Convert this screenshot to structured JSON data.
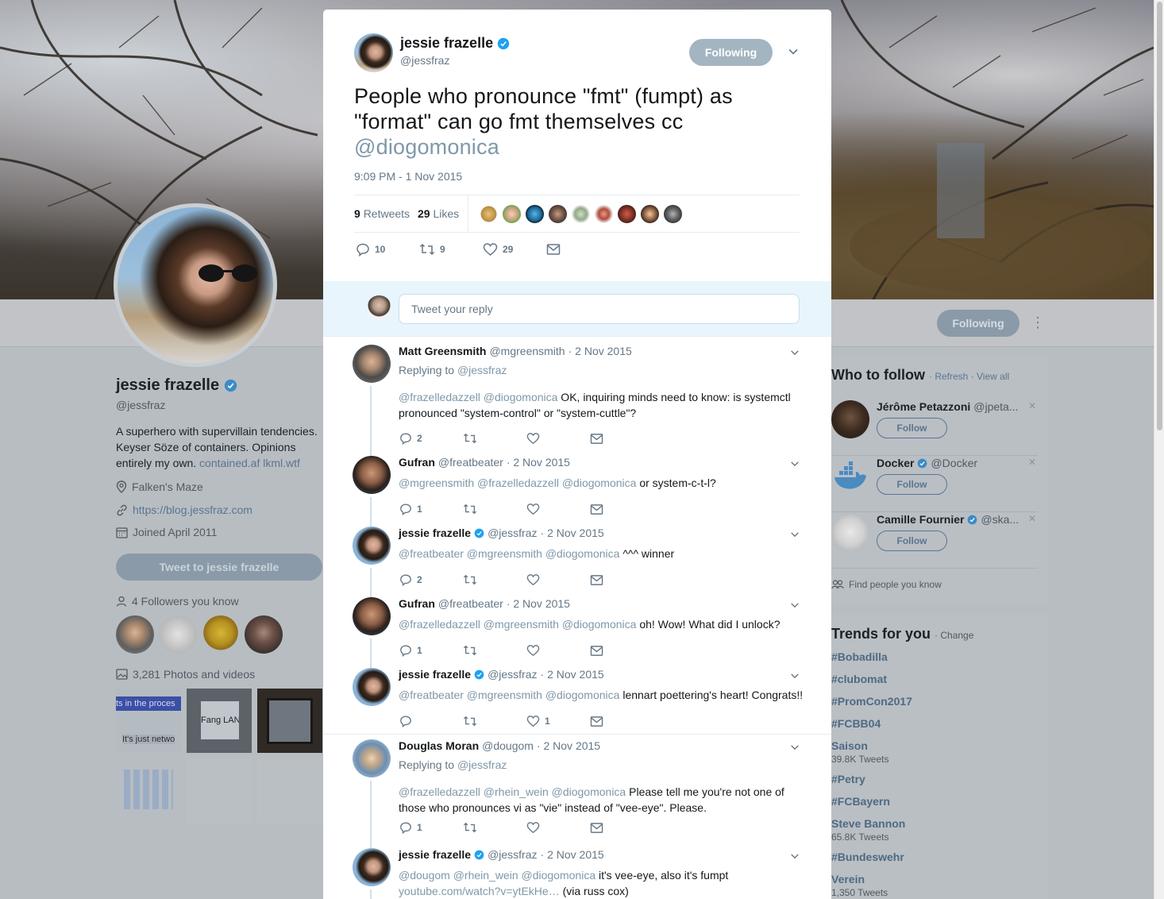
{
  "colors": {
    "accent": "#1da1f2",
    "mention": "#7f98a9",
    "following_button": "#a3b5c1",
    "reply_bar_bg": "#e8f5fd"
  },
  "profile": {
    "name": "jessie frazelle",
    "handle": "@jessfraz",
    "bio_text": "A superhero with supervillain tendencies. Keyser Söze of containers. Opinions entirely my own.",
    "bio_links": [
      "contained.af",
      "lkml.wtf"
    ],
    "location": "Falken's Maze",
    "website": "https://blog.jessfraz.com",
    "joined": "Joined April 2011",
    "tweet_to_button": "Tweet to jessie frazelle",
    "followers_you_know": "4 Followers you know",
    "photos_videos": "3,281 Photos and videos",
    "following_button": "Following",
    "photo_tile_texts": [
      "ts in the proces",
      "It's just netwo",
      "Fang LAN"
    ]
  },
  "who_to_follow": {
    "title": "Who to follow",
    "refresh": "Refresh",
    "view_all": "View all",
    "users": [
      {
        "name": "Jérôme Petazzoni",
        "handle": "@jpeta...",
        "button": "Follow",
        "verified": false
      },
      {
        "name": "Docker",
        "handle": "@Docker",
        "button": "Follow",
        "verified": true
      },
      {
        "name": "Camille Fournier",
        "handle": "@ska...",
        "button": "Follow",
        "verified": true
      }
    ],
    "find_people": "Find people you know"
  },
  "trends": {
    "title": "Trends for you",
    "change": "Change",
    "items": [
      {
        "tag": "#Bobadilla",
        "count": ""
      },
      {
        "tag": "#clubomat",
        "count": ""
      },
      {
        "tag": "#PromCon2017",
        "count": ""
      },
      {
        "tag": "#FCBB04",
        "count": ""
      },
      {
        "tag": "Saison",
        "count": "39.8K Tweets"
      },
      {
        "tag": "#Petry",
        "count": ""
      },
      {
        "tag": "#FCBayern",
        "count": ""
      },
      {
        "tag": "Steve Bannon",
        "count": "65.8K Tweets"
      },
      {
        "tag": "#Bundeswehr",
        "count": ""
      },
      {
        "tag": "Verein",
        "count": "1,350 Tweets"
      }
    ]
  },
  "modal": {
    "author_name": "jessie frazelle",
    "author_handle": "@jessfraz",
    "following_button": "Following",
    "tweet_text_before": "People who pronounce \"fmt\" (fumpt) as \"format\" can go fmt themselves cc ",
    "tweet_mention": "@diogomonica",
    "timestamp": "9:09 PM - 1 Nov 2015",
    "retweets_count": "9",
    "retweets_label": "Retweets",
    "likes_count": "29",
    "likes_label": "Likes",
    "actions": {
      "replies": "10",
      "retweets": "9",
      "likes": "29"
    },
    "reply_placeholder": "Tweet your reply"
  },
  "replies": [
    {
      "name": "Matt Greensmith",
      "handle": "@mgreensmith",
      "date": "· 2 Nov 2015",
      "verified": false,
      "replying_to_label": "Replying to",
      "replying_to": "@jessfraz",
      "mentions": "@frazelledazzell @diogomonica",
      "text": " OK,  inquiring minds need to know: is systemctl pronounced \"system-control\" or \"system-cuttle\"?",
      "reply_count": "2",
      "retweet_count": "",
      "like_count": ""
    },
    {
      "name": "Gufran",
      "handle": "@freatbeater",
      "date": "· 2 Nov 2015",
      "verified": false,
      "mentions": "@mgreensmith @frazelledazzell @diogomonica",
      "text": " or system-c-t-l?",
      "reply_count": "1",
      "retweet_count": "",
      "like_count": ""
    },
    {
      "name": "jessie frazelle",
      "handle": "@jessfraz",
      "date": "· 2 Nov 2015",
      "verified": true,
      "mentions": "@freatbeater @mgreensmith @diogomonica",
      "text": " ^^^ winner",
      "reply_count": "2",
      "retweet_count": "",
      "like_count": ""
    },
    {
      "name": "Gufran",
      "handle": "@freatbeater",
      "date": "· 2 Nov 2015",
      "verified": false,
      "mentions": "@frazelledazzell @mgreensmith @diogomonica",
      "text": " oh! Wow! What did I unlock?",
      "reply_count": "1",
      "retweet_count": "",
      "like_count": ""
    },
    {
      "name": "jessie frazelle",
      "handle": "@jessfraz",
      "date": "· 2 Nov 2015",
      "verified": true,
      "mentions": "@freatbeater @mgreensmith @diogomonica",
      "text": " lennart poettering's heart! Congrats!!",
      "reply_count": "",
      "retweet_count": "",
      "like_count": "1"
    },
    {
      "name": "Douglas Moran",
      "handle": "@dougom",
      "date": "· 2 Nov 2015",
      "verified": false,
      "replying_to_label": "Replying to",
      "replying_to": "@jessfraz",
      "mentions": "@frazelledazzell @rhein_wein @diogomonica",
      "text": " Please tell me you're not one of those who pronounces vi as \"vie\" instead of \"vee-eye\". Please.",
      "reply_count": "1",
      "retweet_count": "",
      "like_count": ""
    },
    {
      "name": "jessie frazelle",
      "handle": "@jessfraz",
      "date": "· 2 Nov 2015",
      "verified": true,
      "mentions": "@dougom @rhein_wein @diogomonica",
      "text": " it's vee-eye, also it's fumpt",
      "link": "youtube.com/watch?v=ytEkHe…",
      "link_suffix": " (via russ cox)",
      "reply_count": "",
      "retweet_count": "",
      "like_count": ""
    }
  ]
}
